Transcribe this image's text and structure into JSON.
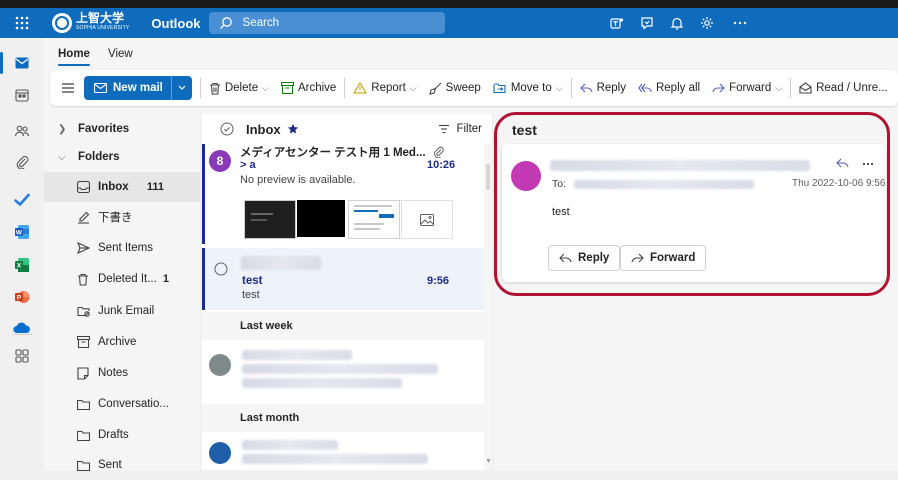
{
  "app": {
    "brand_main": "上智大学",
    "brand_sub": "SOPHIA UNIVERSITY",
    "name": "Outlook",
    "search_placeholder": "Search"
  },
  "ribbon": {
    "tabs": [
      "Home",
      "View"
    ],
    "new_mail": "New mail",
    "commands": {
      "delete": "Delete",
      "archive": "Archive",
      "report": "Report",
      "sweep": "Sweep",
      "move_to": "Move to",
      "reply": "Reply",
      "reply_all": "Reply all",
      "forward": "Forward",
      "read_unread": "Read / Unre..."
    }
  },
  "folders": {
    "favorites": "Favorites",
    "folders": "Folders",
    "items": [
      {
        "label": "Inbox",
        "count": "111",
        "icon": "inbox-icon"
      },
      {
        "label": "下書き",
        "count": "",
        "icon": "draft-icon"
      },
      {
        "label": "Sent Items",
        "count": "",
        "icon": "send-icon"
      },
      {
        "label": "Deleted It...",
        "count": "1",
        "icon": "trash-icon"
      },
      {
        "label": "Junk Email",
        "count": "",
        "icon": "junk-icon"
      },
      {
        "label": "Archive",
        "count": "",
        "icon": "archive-icon"
      },
      {
        "label": "Notes",
        "count": "",
        "icon": "notes-icon"
      },
      {
        "label": "Conversatio...",
        "count": "",
        "icon": "folder-icon"
      },
      {
        "label": "Drafts",
        "count": "",
        "icon": "folder-icon"
      },
      {
        "label": "Sent",
        "count": "",
        "icon": "folder-icon"
      }
    ]
  },
  "list": {
    "title": "Inbox",
    "filter": "Filter",
    "msg1": {
      "avatar_letter": "8",
      "subject": "メディアセンター テスト用 1 Med...",
      "to": "> a",
      "time": "10:26",
      "preview": "No preview is available."
    },
    "msg2": {
      "subject": "test",
      "time": "9:56",
      "preview": "test"
    },
    "group_last_week": "Last week",
    "group_last_month": "Last month"
  },
  "reading": {
    "subject": "test",
    "to_label": "To:",
    "date": "Thu 2022-10-06 9:56",
    "body": "test",
    "reply": "Reply",
    "forward": "Forward"
  },
  "colors": {
    "brand_blue": "#0f6cbd",
    "highlight_red": "#b0122f",
    "avatar_purple": "#8a3ab9",
    "avatar_magenta": "#c239b3",
    "accent_navy": "#1d2b8f"
  }
}
